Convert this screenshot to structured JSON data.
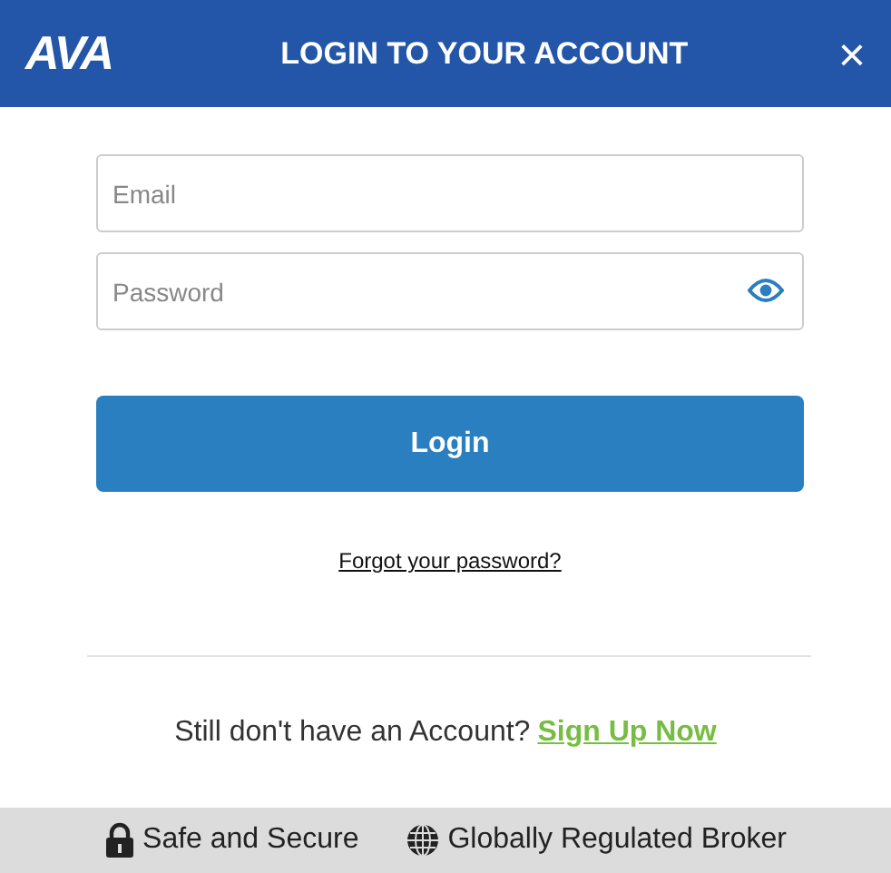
{
  "header": {
    "logo": "AVA",
    "title": "LOGIN TO YOUR ACCOUNT",
    "close": "×"
  },
  "fields": [
    {
      "placeholder": "Email",
      "kind": "text"
    },
    {
      "placeholder": "Password",
      "kind": "password"
    }
  ],
  "login_button": "Login",
  "forgot_link": "Forgot your password?",
  "signup": {
    "prompt": "Still don't have an Account?",
    "link": "Sign Up Now"
  },
  "footer": [
    {
      "label": "Safe and Secure",
      "kind": "lock"
    },
    {
      "label": "Globally Regulated Broker",
      "kind": "globe"
    }
  ]
}
